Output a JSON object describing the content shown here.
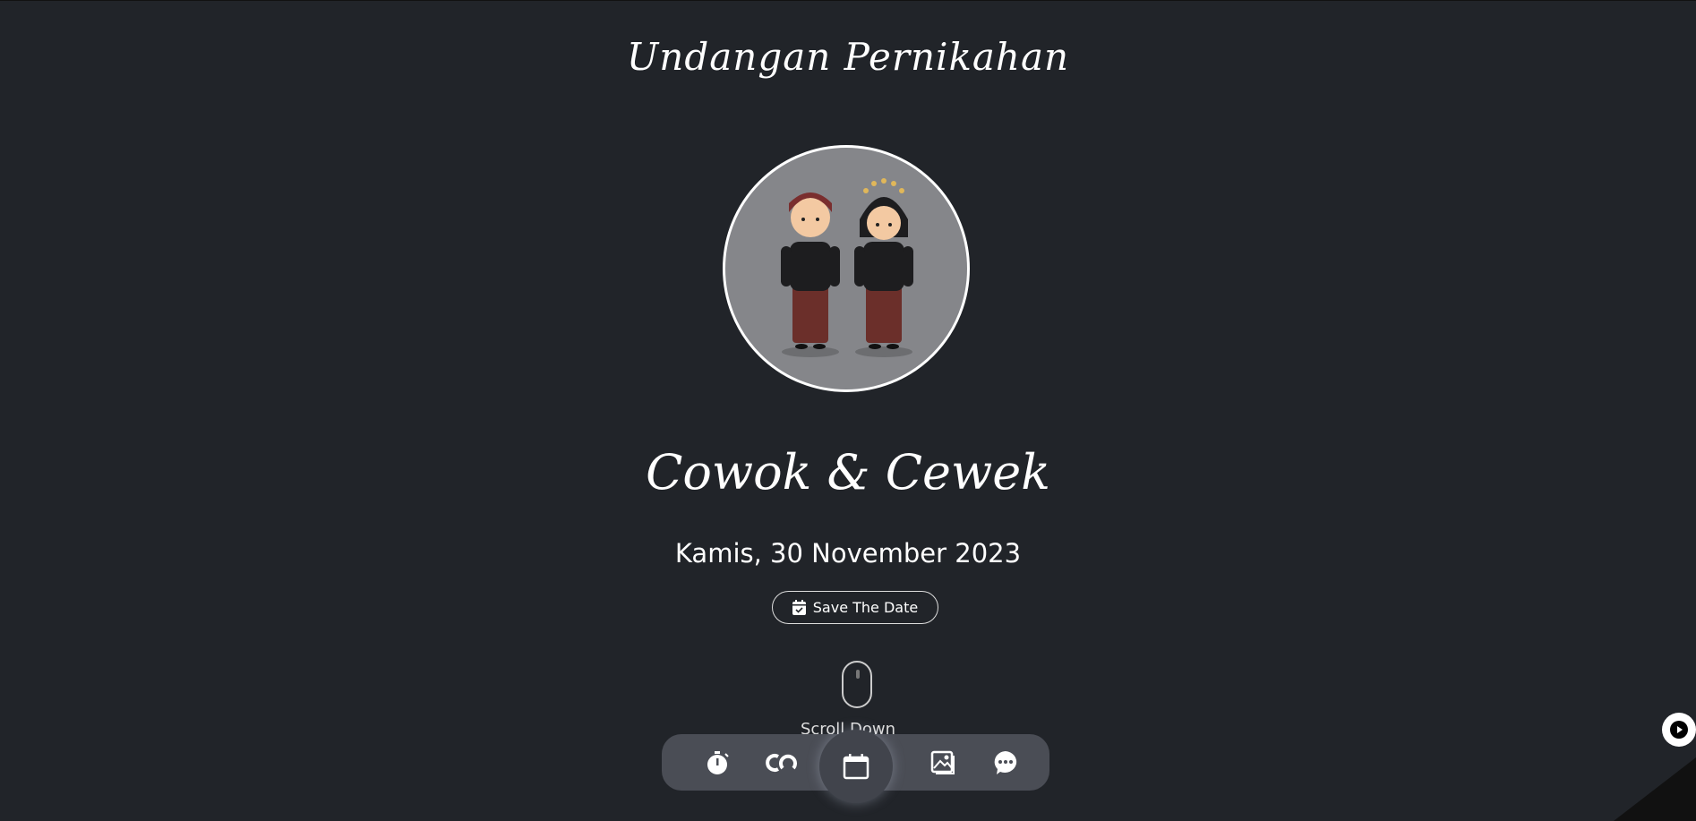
{
  "header": {
    "title": "Undangan Pernikahan"
  },
  "couple": {
    "names": "Cowok & Cewek",
    "date": "Kamis, 30 November 2023"
  },
  "save_button": {
    "label": "Save The Date",
    "icon": "calendar-check-icon"
  },
  "scroll_hint": {
    "label": "Scroll Down"
  },
  "bottom_nav": {
    "items": [
      {
        "icon": "stopwatch-icon"
      },
      {
        "icon": "rings-icon"
      },
      {
        "icon": "calendar-icon",
        "active": true
      },
      {
        "icon": "images-icon"
      },
      {
        "icon": "chat-icon"
      }
    ]
  },
  "music_button": {
    "icon": "play-icon"
  },
  "colors": {
    "background": "#212429",
    "nav": "#4a4d55",
    "photo_bg": "#85868a"
  }
}
